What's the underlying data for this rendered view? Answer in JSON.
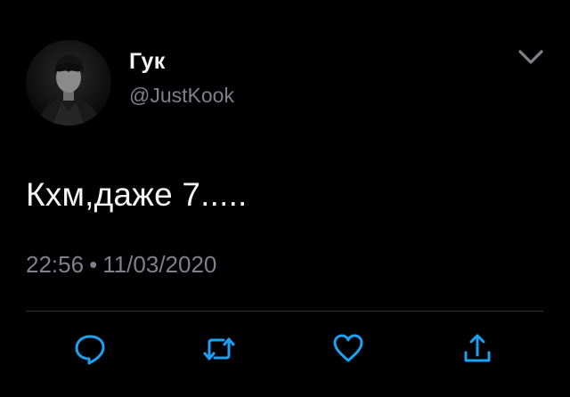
{
  "tweet": {
    "author": {
      "display_name": "Гук",
      "handle": "@JustKook"
    },
    "text": "Кхм,даже 7.....",
    "time": "22:56",
    "separator": "•",
    "date": "11/03/2020"
  },
  "actions": {
    "icons": [
      "reply-icon",
      "retweet-icon",
      "like-icon",
      "share-icon"
    ]
  },
  "colors": {
    "background": "#000000",
    "text": "#f5f5f5",
    "secondary": "#7c8287",
    "divider": "#2f3336",
    "icon": "#1da1f2"
  }
}
